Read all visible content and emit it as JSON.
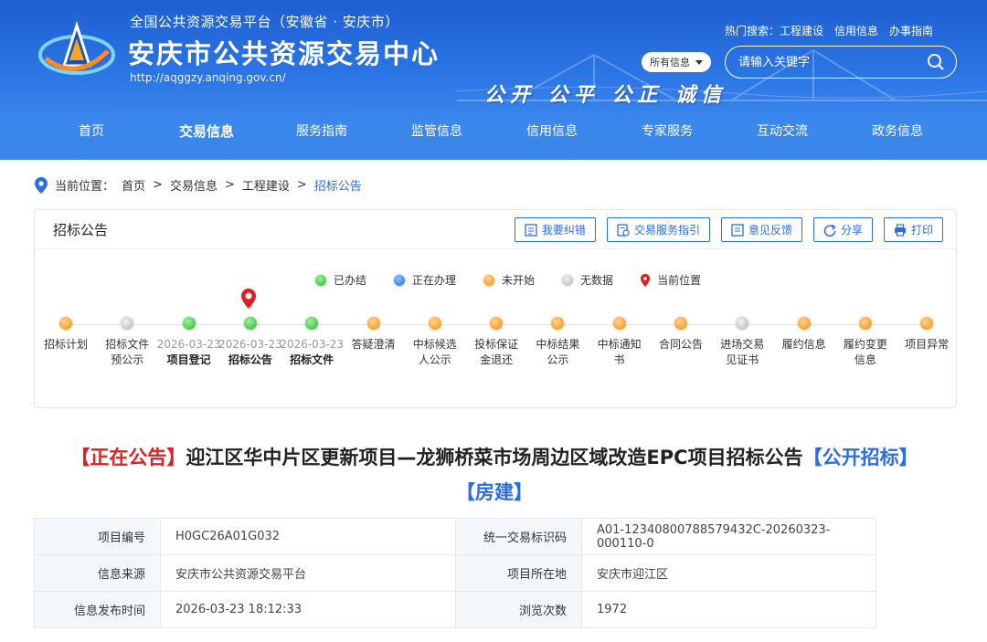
{
  "header": {
    "subtitle": "全国公共资源交易平台（安徽省 · 安庆市）",
    "title": "安庆市公共资源交易中心",
    "url": "http://aqggzy.anqing.gov.cn/",
    "slogan": "公开 公平 公正 诚信",
    "hot_search_label": "热门搜索：工程建设",
    "hot_links": [
      "信用信息",
      "办事指南"
    ],
    "scope_select": "所有信息",
    "search_placeholder": "请输入关键字",
    "accent": "#2b74e4"
  },
  "nav": {
    "items": [
      "首页",
      "交易信息",
      "服务指南",
      "监管信息",
      "信用信息",
      "专家服务",
      "互动交流",
      "政务信息"
    ],
    "active_index": 1
  },
  "breadcrumb": {
    "label": "当前位置：",
    "items": [
      "首页",
      "交易信息",
      "工程建设",
      "招标公告"
    ],
    "sep": ">"
  },
  "panel": {
    "title": "招标公告",
    "tools": [
      {
        "label": "我要纠错",
        "icon": "edit-icon"
      },
      {
        "label": "交易服务指引",
        "icon": "guide-icon"
      },
      {
        "label": "意见反馈",
        "icon": "feedback-icon"
      },
      {
        "label": "分享",
        "icon": "share-icon"
      },
      {
        "label": "打印",
        "icon": "print-icon"
      }
    ],
    "legend": [
      {
        "label": "已办结",
        "status": "done"
      },
      {
        "label": "正在办理",
        "status": "doing"
      },
      {
        "label": "未开始",
        "status": "todo"
      },
      {
        "label": "无数据",
        "status": "none"
      },
      {
        "label": "当前位置",
        "status": "current"
      }
    ],
    "steps": [
      {
        "label": "招标计划",
        "status": "todo"
      },
      {
        "label": "招标文件预公示",
        "status": "none"
      },
      {
        "label": "项目登记",
        "status": "done",
        "date": "2026-03-23"
      },
      {
        "label": "招标公告",
        "status": "done",
        "date": "2026-03-23",
        "current": true
      },
      {
        "label": "招标文件",
        "status": "done",
        "date": "2026-03-23"
      },
      {
        "label": "答疑澄清",
        "status": "todo"
      },
      {
        "label": "中标候选人公示",
        "status": "todo"
      },
      {
        "label": "投标保证金退还",
        "status": "todo"
      },
      {
        "label": "中标结果公示",
        "status": "todo"
      },
      {
        "label": "中标通知书",
        "status": "todo"
      },
      {
        "label": "合同公告",
        "status": "todo"
      },
      {
        "label": "进场交易见证书",
        "status": "none"
      },
      {
        "label": "履约信息",
        "status": "todo"
      },
      {
        "label": "履约变更信息",
        "status": "todo"
      },
      {
        "label": "项目异常",
        "status": "todo"
      }
    ]
  },
  "notice": {
    "status_tag": "【正在公告】",
    "title": "迎江区华中片区更新项目—龙狮桥菜市场周边区域改造EPC项目招标公告",
    "tag1": "【公开招标】",
    "tag2": "【房建】"
  },
  "info": {
    "rows": [
      [
        {
          "k": "项目编号",
          "v": "H0GC26A01G032"
        },
        {
          "k": "统一交易标识码",
          "v": "A01-12340800788579432C-20260323-000110-0"
        }
      ],
      [
        {
          "k": "信息来源",
          "v": "安庆市公共资源交易平台"
        },
        {
          "k": "项目所在地",
          "v": "安庆市迎江区"
        }
      ],
      [
        {
          "k": "信息发布时间",
          "v": "2026-03-23 18:12:33"
        },
        {
          "k": "浏览次数",
          "v": "1972"
        }
      ]
    ]
  }
}
